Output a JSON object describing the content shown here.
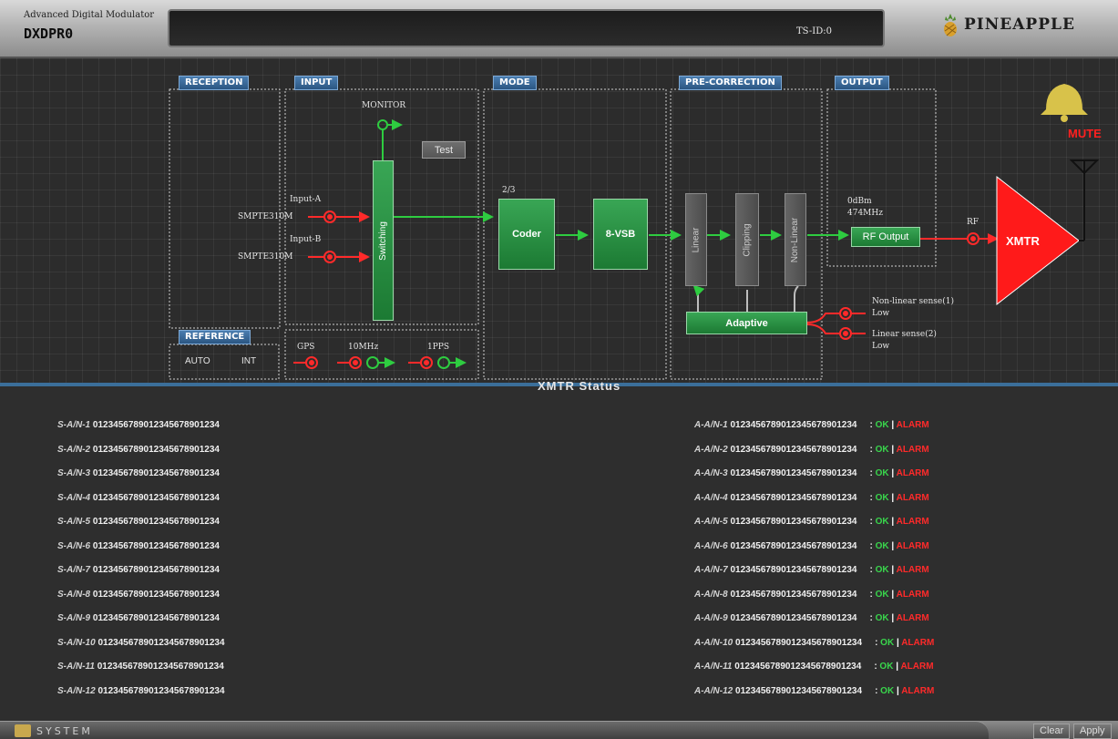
{
  "header": {
    "subtitle": "Advanced Digital Modulator",
    "title": "DXDPR0",
    "ts_id": "TS-ID:0",
    "brand": "PINEAPPLE"
  },
  "diagram": {
    "sections": {
      "reception": "RECEPTION",
      "input": "INPUT",
      "mode": "MODE",
      "precorrection": "PRE-CORRECTION",
      "output": "OUTPUT",
      "reference": "REFERENCE"
    },
    "input": {
      "monitor": "MONITOR",
      "test_button": "Test",
      "input_a": "Input-A",
      "input_a_format": "SMPTE310M",
      "input_b": "Input-B",
      "input_b_format": "SMPTE310M",
      "switching": "Switching"
    },
    "reference": {
      "mode": "AUTO",
      "source": "INT",
      "gps": "GPS",
      "mhz10": "10MHz",
      "pps": "1PPS"
    },
    "mode": {
      "code_rate": "2/3",
      "coder": "Coder",
      "modulation": "8-VSB"
    },
    "precorrection": {
      "linear": "Linear",
      "clipping": "Clipping",
      "nonlinear": "Non-Linear",
      "adaptive": "Adaptive",
      "nonlinear_sense": "Non-linear sense(1)",
      "nonlinear_sense_value": "Low",
      "linear_sense": "Linear sense(2)",
      "linear_sense_value": "Low"
    },
    "output": {
      "power": "0dBm",
      "frequency": "474MHz",
      "rf_output": "RF Output",
      "rf": "RF",
      "xmtr": "XMTR",
      "mute": "MUTE"
    }
  },
  "status": {
    "title": "XMTR Status",
    "ok_label": "OK",
    "alarm_label": "ALARM",
    "s_rows": [
      {
        "label": "S-A/N-1",
        "value": "0123456789012345678901234"
      },
      {
        "label": "S-A/N-2",
        "value": "0123456789012345678901234"
      },
      {
        "label": "S-A/N-3",
        "value": "0123456789012345678901234"
      },
      {
        "label": "S-A/N-4",
        "value": "0123456789012345678901234"
      },
      {
        "label": "S-A/N-5",
        "value": "0123456789012345678901234"
      },
      {
        "label": "S-A/N-6",
        "value": "0123456789012345678901234"
      },
      {
        "label": "S-A/N-7",
        "value": "0123456789012345678901234"
      },
      {
        "label": "S-A/N-8",
        "value": "0123456789012345678901234"
      },
      {
        "label": "S-A/N-9",
        "value": "0123456789012345678901234"
      },
      {
        "label": "S-A/N-10",
        "value": "0123456789012345678901234"
      },
      {
        "label": "S-A/N-11",
        "value": "0123456789012345678901234"
      },
      {
        "label": "S-A/N-12",
        "value": "0123456789012345678901234"
      }
    ],
    "a_rows": [
      {
        "label": "A-A/N-1",
        "value": "0123456789012345678901234"
      },
      {
        "label": "A-A/N-2",
        "value": "0123456789012345678901234"
      },
      {
        "label": "A-A/N-3",
        "value": "0123456789012345678901234"
      },
      {
        "label": "A-A/N-4",
        "value": "0123456789012345678901234"
      },
      {
        "label": "A-A/N-5",
        "value": "0123456789012345678901234"
      },
      {
        "label": "A-A/N-6",
        "value": "0123456789012345678901234"
      },
      {
        "label": "A-A/N-7",
        "value": "0123456789012345678901234"
      },
      {
        "label": "A-A/N-8",
        "value": "0123456789012345678901234"
      },
      {
        "label": "A-A/N-9",
        "value": "0123456789012345678901234"
      },
      {
        "label": "A-A/N-10",
        "value": "0123456789012345678901234"
      },
      {
        "label": "A-A/N-11",
        "value": "0123456789012345678901234"
      },
      {
        "label": "A-A/N-12",
        "value": "0123456789012345678901234"
      }
    ]
  },
  "footer": {
    "system_tab": "SYSTEM",
    "clear_button": "Clear",
    "apply_button": "Apply"
  },
  "colors": {
    "signal_green": "#2ecc40",
    "signal_red": "#ff2a2a",
    "section_blue": "#3a6fa3",
    "xmtr_red": "#ff1a1a",
    "bell": "#d8c24a"
  },
  "icons": [
    "pineapple-logo-icon",
    "bell-icon",
    "antenna-icon",
    "connector-icon",
    "system-icon"
  ]
}
